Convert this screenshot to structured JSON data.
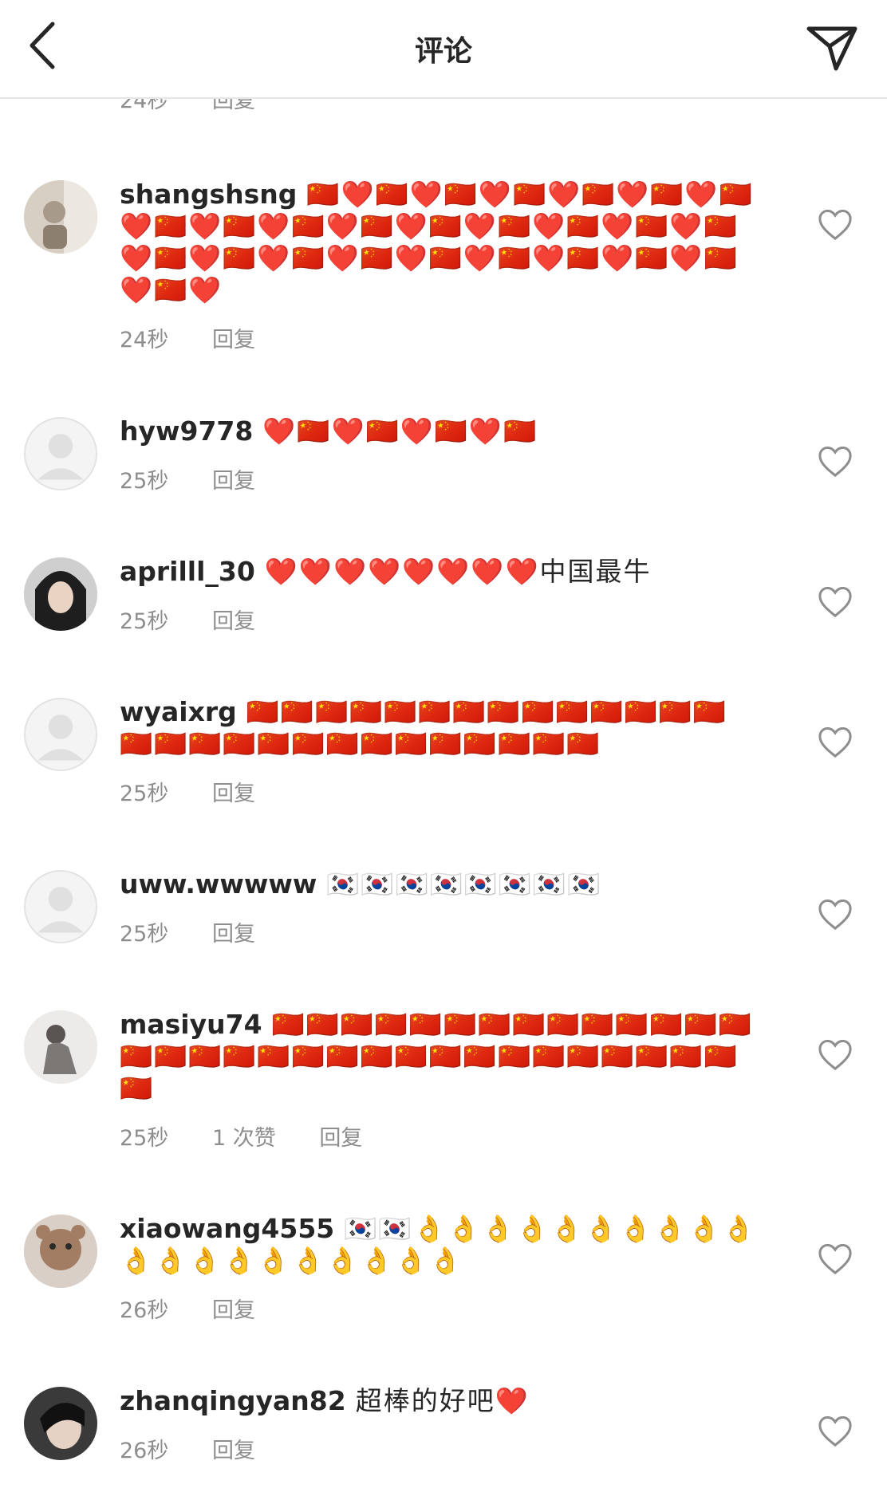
{
  "header": {
    "title": "评论",
    "back_icon": "chevron-left-icon",
    "share_icon": "paper-plane-icon"
  },
  "partial": {
    "time": "24秒",
    "reply": "回复"
  },
  "comments": [
    {
      "username": "shangshsng",
      "text": "🇨🇳❤️🇨🇳❤️🇨🇳❤️🇨🇳❤️🇨🇳❤️🇨🇳❤️🇨🇳❤️🇨🇳❤️🇨🇳❤️🇨🇳❤️🇨🇳❤️🇨🇳❤️🇨🇳❤️🇨🇳❤️🇨🇳❤️🇨🇳❤️🇨🇳❤️🇨🇳❤️🇨🇳❤️🇨🇳❤️🇨🇳❤️🇨🇳❤️🇨🇳❤️🇨🇳❤️🇨🇳❤️🇨🇳❤️",
      "time": "24秒",
      "likes": "",
      "reply": "回复",
      "avatar": "photo"
    },
    {
      "username": "hyw9778",
      "text": "❤️🇨🇳❤️🇨🇳❤️🇨🇳❤️🇨🇳",
      "time": "25秒",
      "likes": "",
      "reply": "回复",
      "avatar": "default"
    },
    {
      "username": "aprilll_30",
      "text": "❤️❤️❤️❤️❤️❤️❤️❤️中国最牛",
      "time": "25秒",
      "likes": "",
      "reply": "回复",
      "avatar": "photo"
    },
    {
      "username": "wyaixrg",
      "text": "🇨🇳🇨🇳🇨🇳🇨🇳🇨🇳🇨🇳🇨🇳🇨🇳🇨🇳🇨🇳🇨🇳🇨🇳🇨🇳🇨🇳🇨🇳🇨🇳🇨🇳🇨🇳🇨🇳🇨🇳🇨🇳🇨🇳🇨🇳🇨🇳🇨🇳🇨🇳🇨🇳🇨🇳",
      "time": "25秒",
      "likes": "",
      "reply": "回复",
      "avatar": "default"
    },
    {
      "username": "uww.wwwww",
      "text": "🇰🇷🇰🇷🇰🇷🇰🇷🇰🇷🇰🇷🇰🇷🇰🇷",
      "time": "25秒",
      "likes": "",
      "reply": "回复",
      "avatar": "default"
    },
    {
      "username": "masiyu74",
      "text": "🇨🇳🇨🇳🇨🇳🇨🇳🇨🇳🇨🇳🇨🇳🇨🇳🇨🇳🇨🇳🇨🇳🇨🇳🇨🇳🇨🇳🇨🇳🇨🇳🇨🇳🇨🇳🇨🇳🇨🇳🇨🇳🇨🇳🇨🇳🇨🇳🇨🇳🇨🇳🇨🇳🇨🇳🇨🇳🇨🇳🇨🇳🇨🇳🇨🇳",
      "time": "25秒",
      "likes": "1 次赞",
      "reply": "回复",
      "avatar": "photo"
    },
    {
      "username": "xiaowang4555",
      "text": "🇰🇷🇰🇷👌👌👌👌👌👌👌👌👌👌👌👌👌👌👌👌👌👌👌👌",
      "time": "26秒",
      "likes": "",
      "reply": "回复",
      "avatar": "photo"
    },
    {
      "username": "zhanqingyan82",
      "text": "超棒的好吧❤️",
      "time": "26秒",
      "likes": "",
      "reply": "回复",
      "avatar": "photo"
    }
  ],
  "colors": {
    "text": "#262626",
    "meta": "#8e8e8e",
    "divider": "#e6e6e6"
  }
}
